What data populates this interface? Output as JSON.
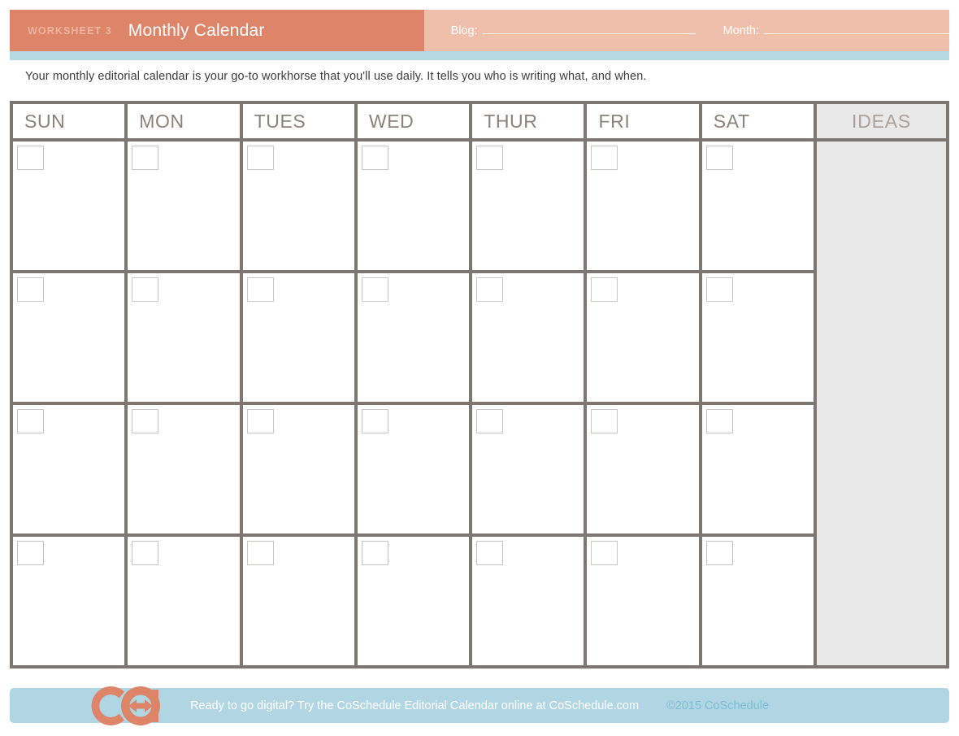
{
  "header": {
    "worksheet_label": "WORKSHEET 3",
    "title": "Monthly Calendar",
    "fields": [
      {
        "label": "Blog:",
        "value": ""
      },
      {
        "label": "Month:",
        "value": ""
      }
    ],
    "bar_color": "#de8468",
    "bar_color_light": "#efbfab",
    "strip_color": "#b6d8e5"
  },
  "intro": {
    "text": "Your monthly editorial calendar is your go-to workhorse that you'll use daily. It tells you who is writing what, and when."
  },
  "calendar": {
    "day_headers": [
      "SUN",
      "MON",
      "TUES",
      "WED",
      "THUR",
      "FRI",
      "SAT"
    ],
    "ideas_header": "IDEAS",
    "week_rows": 4,
    "cells": [
      [
        "",
        "",
        "",
        "",
        "",
        "",
        ""
      ],
      [
        "",
        "",
        "",
        "",
        "",
        "",
        ""
      ],
      [
        "",
        "",
        "",
        "",
        "",
        "",
        ""
      ],
      [
        "",
        "",
        "",
        "",
        "",
        "",
        ""
      ]
    ],
    "ideas_notes": "",
    "border_color": "#7d7672",
    "ideas_bg": "#e9e9e9",
    "header_text_color": "#8a827e"
  },
  "footer": {
    "logo_name": "coschedule-logo",
    "promo_text": "Ready to go digital? Try the CoSchedule Editorial Calendar online at CoSchedule.com",
    "copyright": "©2015 CoSchedule",
    "bar_color": "#b0d5e3",
    "logo_color": "#de8468"
  }
}
